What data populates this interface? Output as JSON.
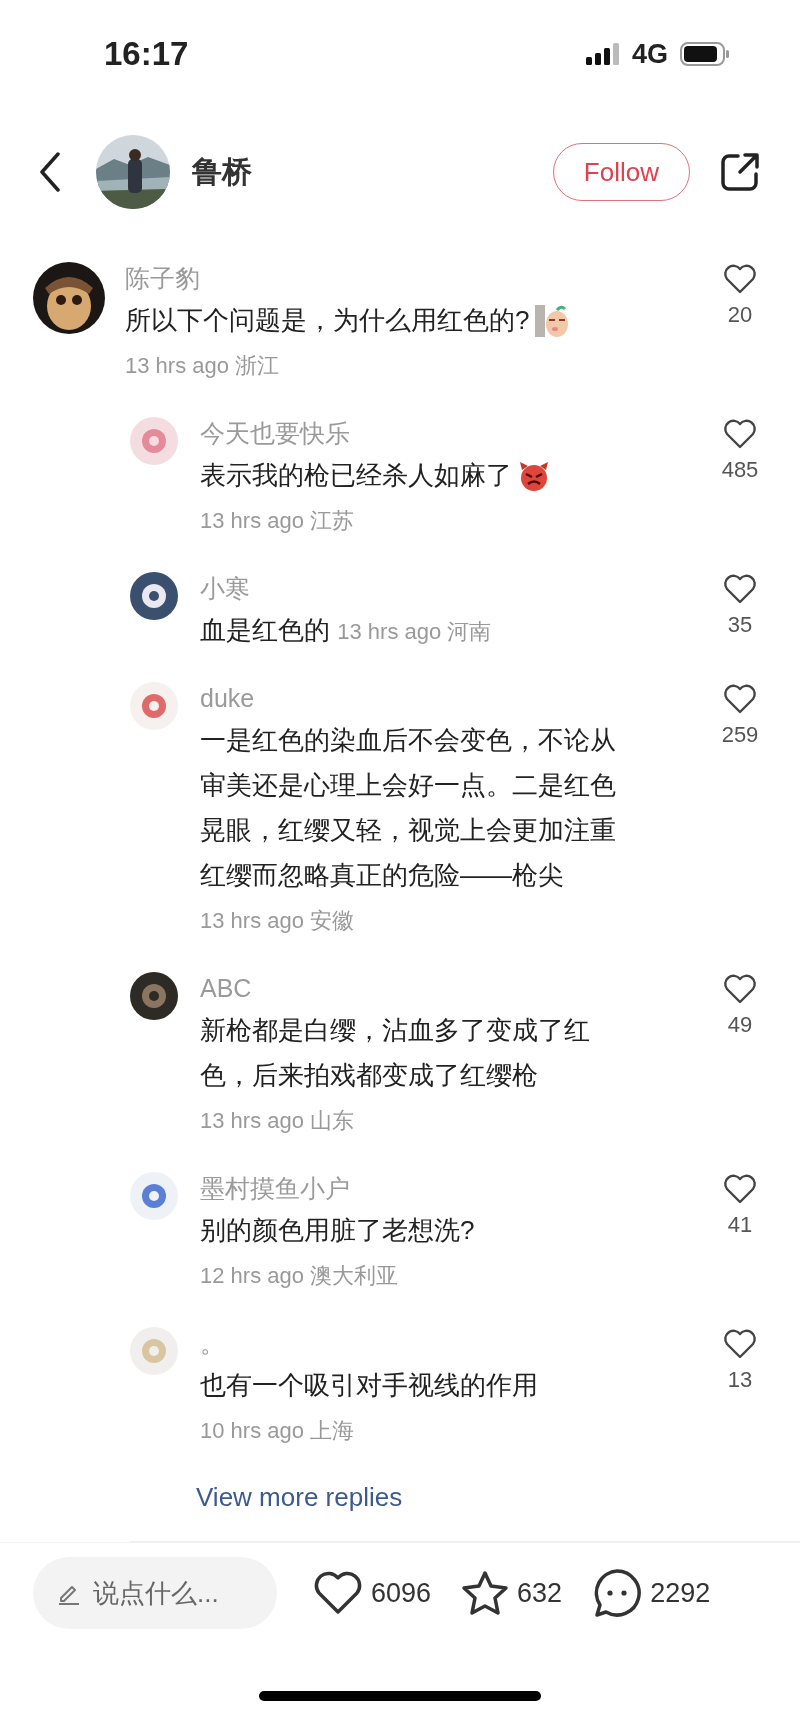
{
  "status_bar": {
    "time": "16:17",
    "network": "4G"
  },
  "header": {
    "user": "鲁桥",
    "follow_label": "Follow"
  },
  "comment": {
    "author": "陈子豹",
    "text": "所以下个问题是，为什么用红色的?",
    "time": "13 hrs ago",
    "location": "浙江",
    "likes": "20"
  },
  "replies": [
    {
      "author": "今天也要快乐",
      "text": "表示我的枪已经杀人如麻了",
      "time": "13 hrs ago",
      "location": "江苏",
      "likes": "485",
      "kind": "devil_emoji"
    },
    {
      "author": "小寒",
      "text": "血是红色的",
      "time": "13 hrs ago",
      "location": "河南",
      "likes": "35",
      "kind": "inline_time"
    },
    {
      "author": "duke",
      "text": "一是红色的染血后不会变色，不论从审美还是心理上会好一点。二是红色晃眼，红缨又轻，视觉上会更加注重红缨而忽略真正的危险——枪尖",
      "time": "13 hrs ago",
      "location": "安徽",
      "likes": "259",
      "kind": "plain"
    },
    {
      "author": "ABC",
      "text": "新枪都是白缨，沾血多了变成了红色，后来拍戏都变成了红缨枪",
      "time": "13 hrs ago",
      "location": "山东",
      "likes": "49",
      "kind": "plain"
    },
    {
      "author": "墨村摸鱼小户",
      "text": "别的颜色用脏了老想洗?",
      "time": "12 hrs ago",
      "location": "澳大利亚",
      "likes": "41",
      "kind": "plain"
    },
    {
      "author": "。",
      "text": "也有一个吸引对手视线的作用",
      "time": "10 hrs ago",
      "location": "上海",
      "likes": "13",
      "kind": "plain"
    }
  ],
  "view_more": "View more replies",
  "bottom_bar": {
    "placeholder": "说点什么...",
    "likes": "6096",
    "favorites": "632",
    "comments": "2292"
  }
}
